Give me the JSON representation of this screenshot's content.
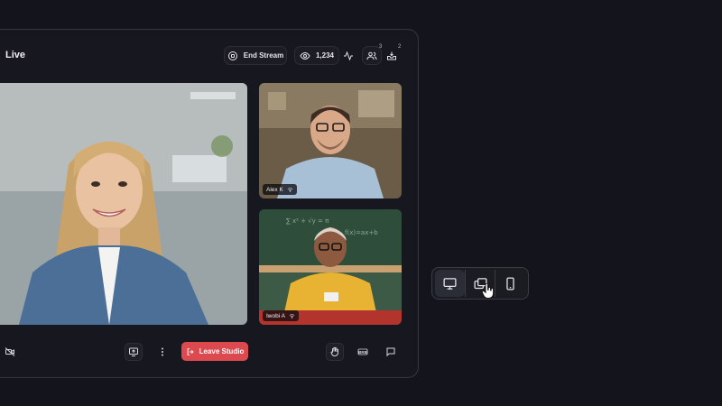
{
  "header": {
    "live_label": "Live",
    "end_stream_label": "End Stream",
    "viewer_count": "1,234",
    "participants_badge": "3",
    "requests_badge": "2"
  },
  "participants": [
    {
      "name": "Alex K"
    },
    {
      "name": "Iwobi A"
    }
  ],
  "controls": {
    "leave_label": "Leave Studio",
    "brb_label": "BRB"
  },
  "colors": {
    "background": "#14151c",
    "panel": "#17181f",
    "leave_button": "#dc4a4f"
  },
  "layout_switcher": {
    "options": [
      "desktop-icon",
      "picture-in-picture-icon",
      "mobile-icon"
    ],
    "selected": "desktop-icon"
  }
}
